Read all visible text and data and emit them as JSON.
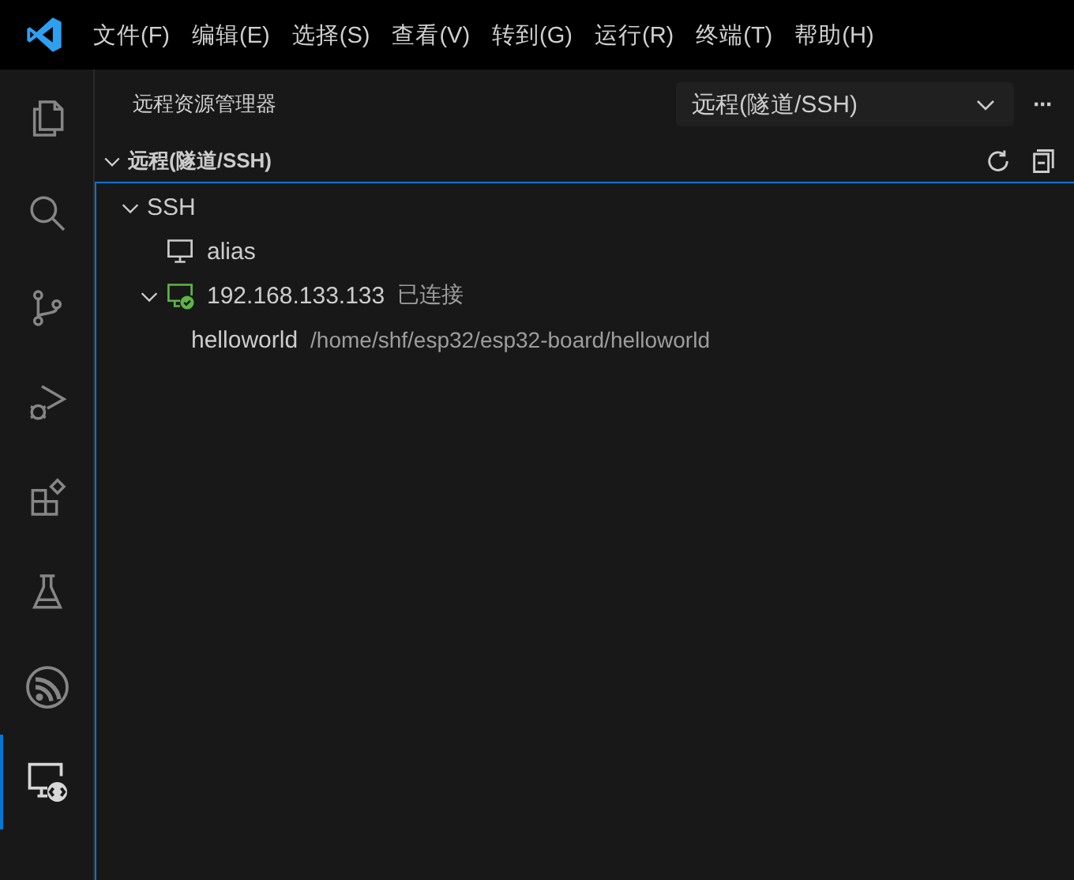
{
  "menu": [
    "文件(F)",
    "编辑(E)",
    "选择(S)",
    "查看(V)",
    "转到(G)",
    "运行(R)",
    "终端(T)",
    "帮助(H)"
  ],
  "activity_bar": [
    {
      "kind": "files",
      "selected": false
    },
    {
      "kind": "search",
      "selected": false
    },
    {
      "kind": "source-control",
      "selected": false
    },
    {
      "kind": "run-debug",
      "selected": false
    },
    {
      "kind": "extensions",
      "selected": false
    },
    {
      "kind": "testing",
      "selected": false
    },
    {
      "kind": "wifi",
      "selected": false
    },
    {
      "kind": "remote",
      "selected": true
    }
  ],
  "sidebar": {
    "title": "远程资源管理器",
    "dropdown": "远程(隧道/SSH)",
    "more": "···",
    "section": {
      "title": "远程(隧道/SSH)",
      "expanded": true,
      "tree": [
        {
          "kind": "group",
          "label": "SSH",
          "expanded": true,
          "children": [
            {
              "kind": "host",
              "label": "alias"
            },
            {
              "kind": "host",
              "label": "192.168.133.133",
              "status": "已连接",
              "connected": true,
              "expanded": true,
              "children": [
                {
                  "kind": "folder",
                  "label": "helloworld",
                  "description": "/home/shf/esp32/esp32-board/helloworld"
                }
              ]
            }
          ]
        }
      ]
    }
  }
}
